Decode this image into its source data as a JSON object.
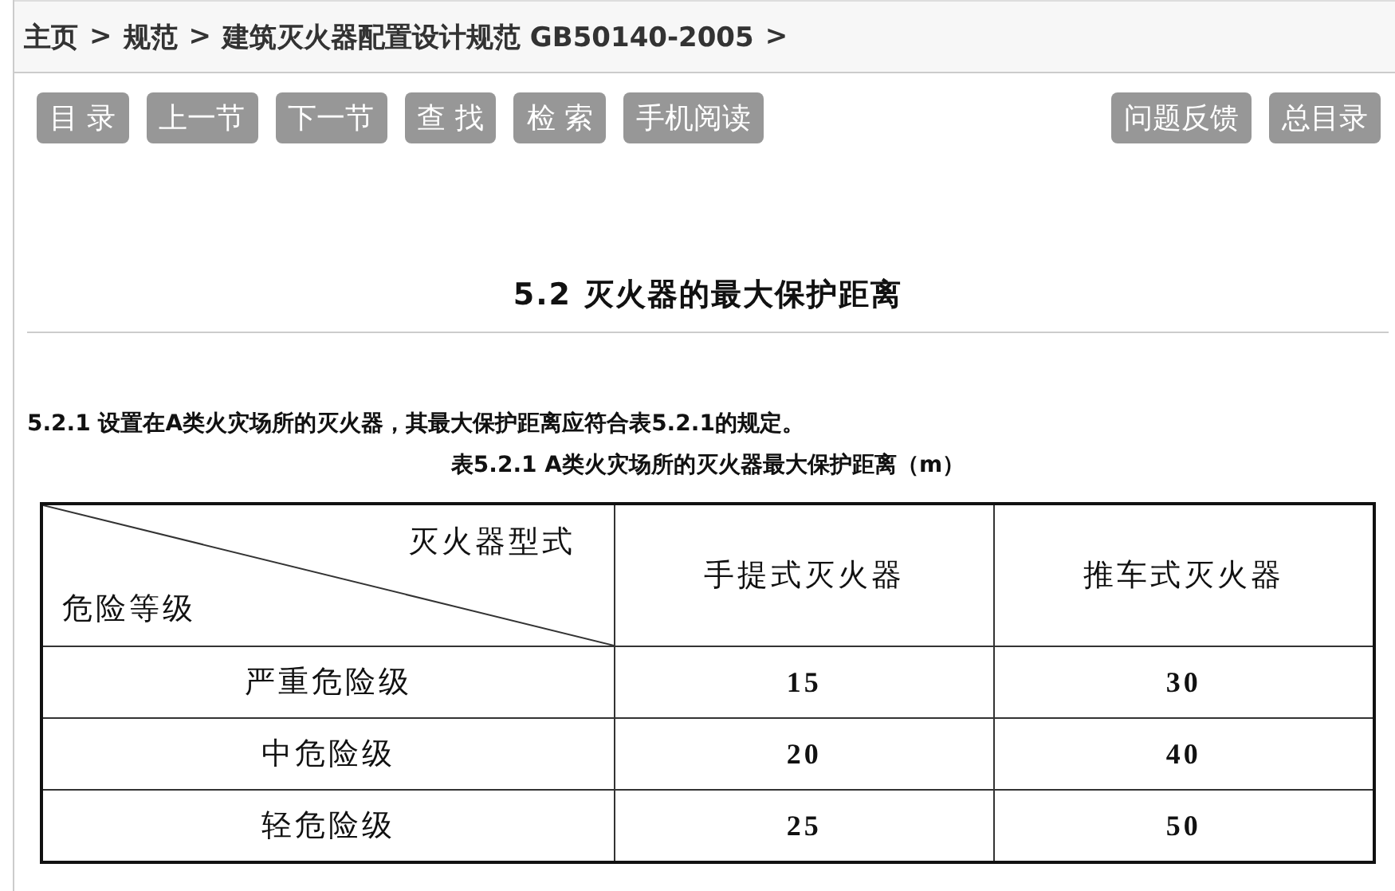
{
  "breadcrumb": [
    {
      "label": "主页",
      "separator": ">"
    },
    {
      "label": "规范",
      "separator": ">"
    },
    {
      "label": "建筑灭火器配置设计规范 GB50140-2005",
      "separator": ">"
    }
  ],
  "toolbar": {
    "left": [
      "目 录",
      "上一节",
      "下一节",
      "查 找",
      "检 索",
      "手机阅读"
    ],
    "right": [
      "问题反馈",
      "总目录"
    ]
  },
  "section_title": "5.2 灭火器的最大保护距离",
  "clause": "5.2.1 设置在A类火灾场所的灭火器，其最大保护距离应符合表5.2.1的规定。",
  "table": {
    "caption": "表5.2.1 A类火灾场所的灭火器最大保护距离（m）",
    "corner": {
      "top": "灭火器型式",
      "bottom": "危险等级"
    },
    "columns": [
      "手提式灭火器",
      "推车式灭火器"
    ],
    "rows": [
      {
        "level": "严重危险级",
        "values": [
          "15",
          "30"
        ]
      },
      {
        "level": "中危险级",
        "values": [
          "20",
          "40"
        ]
      },
      {
        "level": "轻危险级",
        "values": [
          "25",
          "50"
        ]
      }
    ]
  }
}
